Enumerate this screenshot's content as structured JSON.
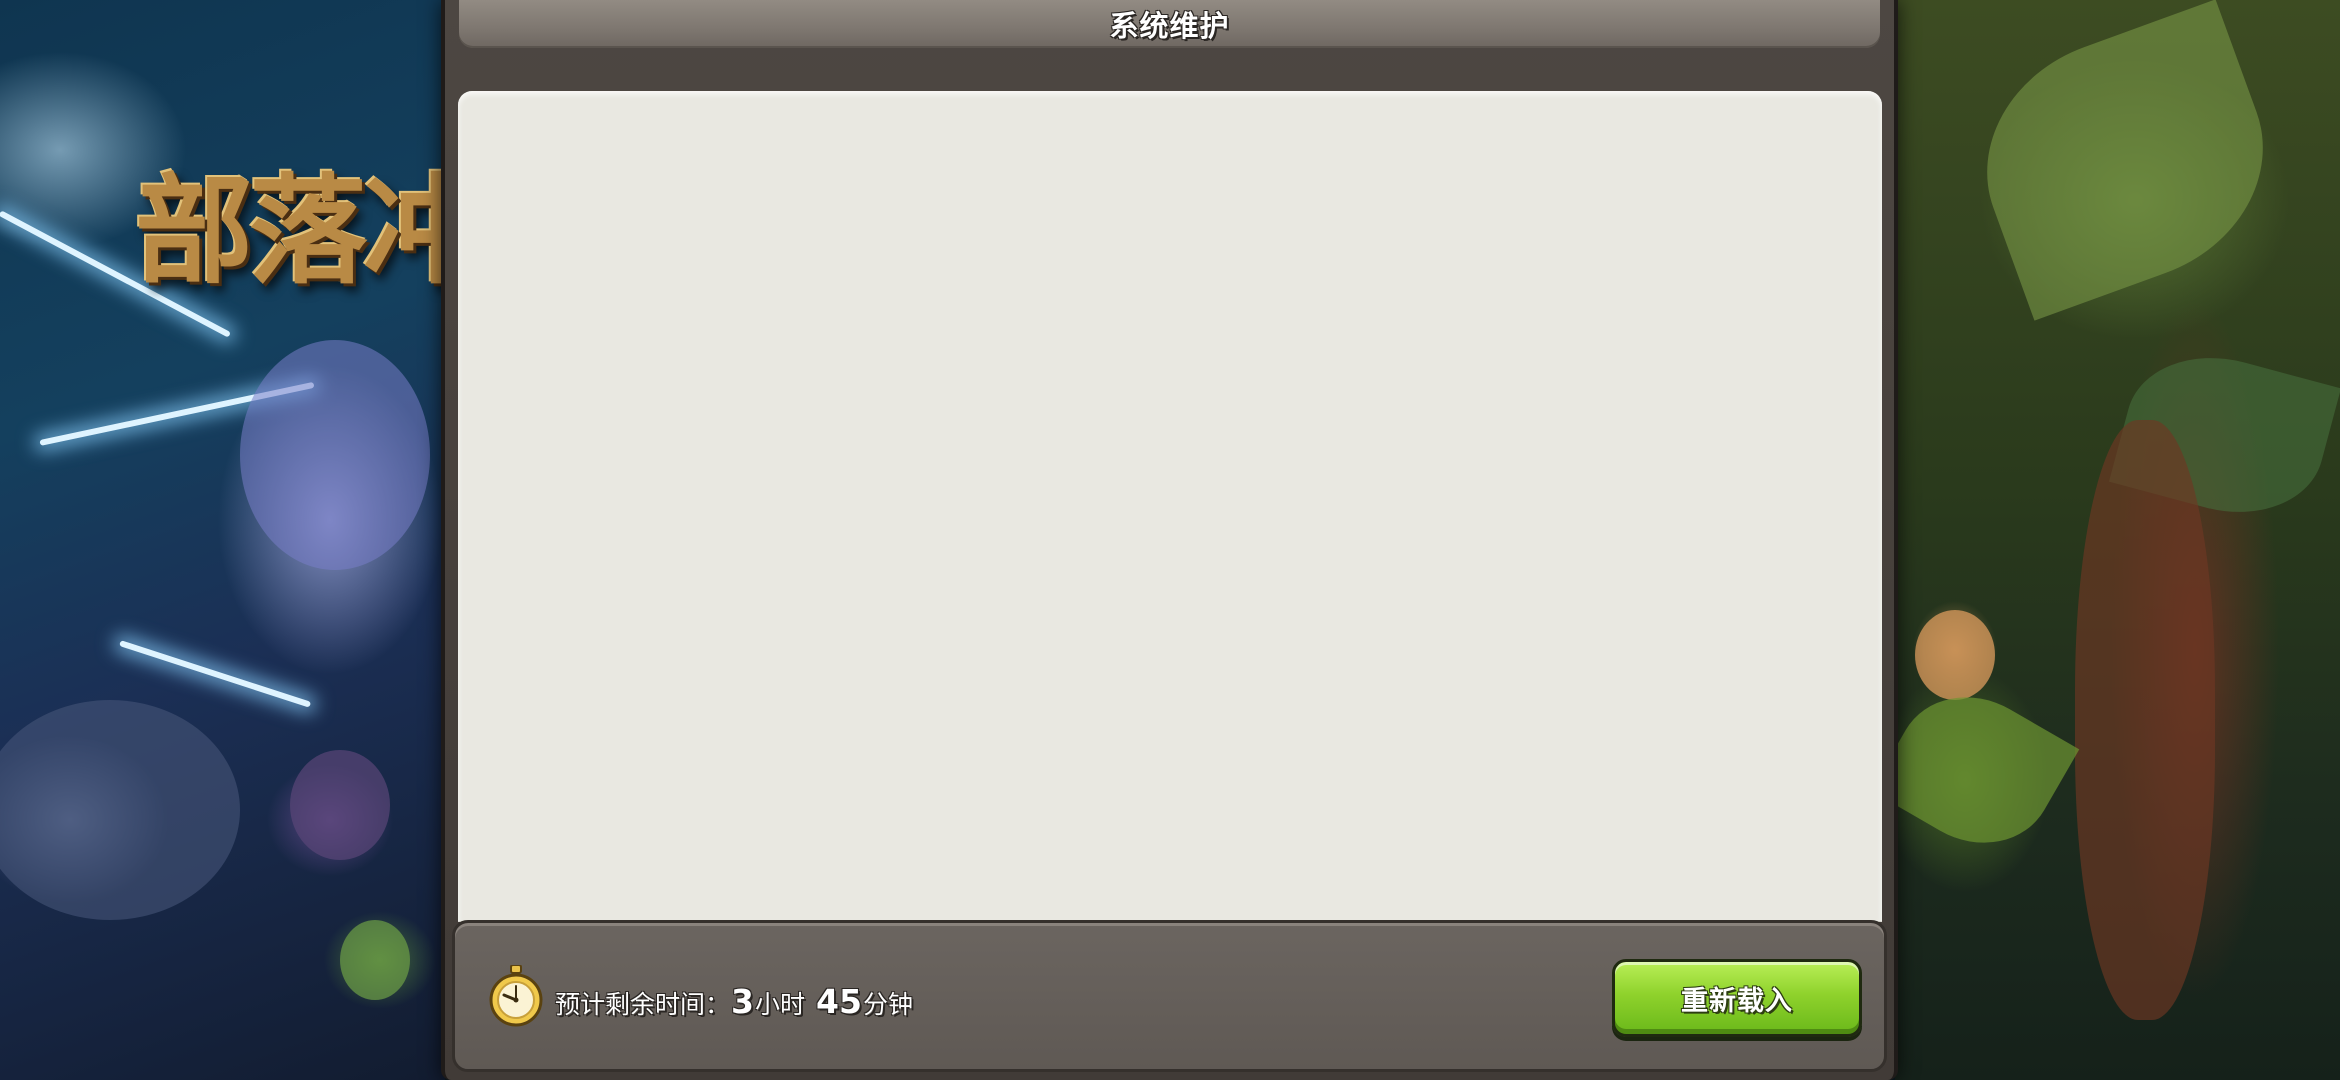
{
  "background": {
    "game_logo_text": "部落冲",
    "left_art": "lightning-dragon-scene",
    "right_art": "jungle-barbarian-scene"
  },
  "dialog": {
    "title": "系统维护",
    "message": ""
  },
  "footer": {
    "timer_label": "预计剩余时间：",
    "hours_value": "3",
    "hours_unit": "小时",
    "minutes_value": "45",
    "minutes_unit": "分钟",
    "timer_icon": "stopwatch-icon",
    "reload_label": "重新载入"
  },
  "colors": {
    "dialog_frame": "#4d4742",
    "content_panel": "#e9e8e1",
    "button_green": "#8fd22c",
    "footer_bar": "#655f5a"
  }
}
